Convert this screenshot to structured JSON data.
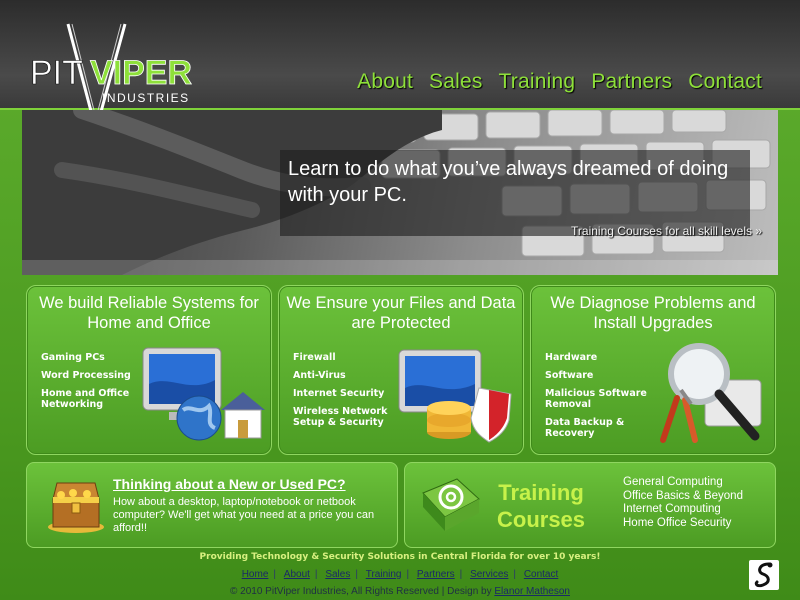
{
  "logo": {
    "part1": "PIT",
    "part2": "VIPER",
    "sub": "INDUSTRIES"
  },
  "nav": [
    "About",
    "Sales",
    "Training",
    "Partners",
    "Contact"
  ],
  "hero": {
    "headline": "Learn to do what you’ve always dreamed of doing with your PC.",
    "link": "Training Courses for all skill levels »"
  },
  "cards": [
    {
      "title": "We build Reliable Systems for Home and Office",
      "items": [
        "Gaming PCs",
        "Word Processing",
        "Home and Office Networking"
      ],
      "icon": "computer-globe-house-icon"
    },
    {
      "title": "We Ensure your Files and Data are Protected",
      "items": [
        "Firewall",
        "Anti-Virus",
        "Internet Security",
        "Wireless Network Setup & Security"
      ],
      "icon": "computer-database-shield-icon"
    },
    {
      "title": "We Diagnose Problems and Install Upgrades",
      "items": [
        "Hardware",
        "Software",
        "Malicious Software Removal",
        "Data Backup & Recovery"
      ],
      "icon": "magnifier-tools-icon"
    }
  ],
  "promo": {
    "title": "Thinking about a New or Used PC?",
    "text": "How about a desktop, laptop/notebook or netbook computer? We'll get what you need at a price you can afford!!",
    "icon": "treasure-chest-icon"
  },
  "training": {
    "title_line1": "Training",
    "title_line2": "Courses",
    "items": [
      "General Computing",
      "Office Basics & Beyond",
      "Internet Computing",
      "Home Office Security"
    ],
    "icon": "at-book-icon"
  },
  "footer": {
    "tagline": "Providing Technology & Security Solutions in Central Florida for over 10 years!",
    "links": [
      "Home",
      "About",
      "Sales",
      "Training",
      "Partners",
      "Services",
      "Contact"
    ],
    "copyright": "© 2010 PitViper Industries, All Rights Reserved | Design by",
    "designer": "Elanor Matheson"
  },
  "colors": {
    "accent": "#8ee03a",
    "panel": "#5aae2c",
    "header": "#333333"
  }
}
